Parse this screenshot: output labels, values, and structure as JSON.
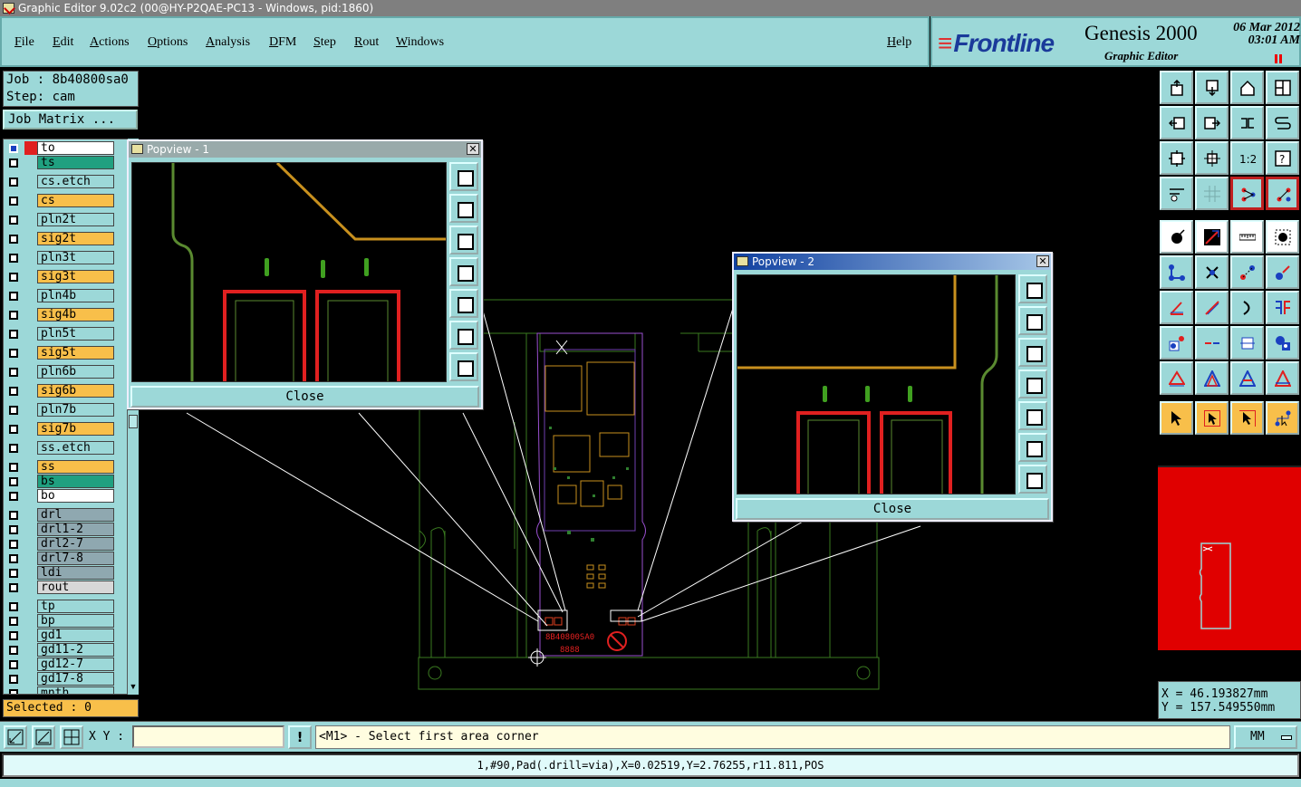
{
  "window": {
    "title": "Graphic Editor 9.02c2 (00@HY-P2QAE-PC13 - Windows, pid:1860)"
  },
  "menu": {
    "items": [
      "File",
      "Edit",
      "Actions",
      "Options",
      "Analysis",
      "DFM",
      "Step",
      "Rout",
      "Windows"
    ],
    "help": "Help"
  },
  "brand": {
    "logo": "Frontline",
    "product": "Genesis 2000",
    "subtitle": "Graphic Editor",
    "date": "06 Mar 2012",
    "time": "03:01 AM"
  },
  "job": {
    "job_line": "Job : 8b40800sa0",
    "step_line": "Step: cam",
    "matrix_button": "Job Matrix ..."
  },
  "layers": [
    {
      "name": "to",
      "color": "#ffffff",
      "swatch": "#e02020",
      "active": true
    },
    {
      "name": "ts",
      "color": "#20a080"
    },
    {
      "name": "cs.etch",
      "color": "#9cd8d8"
    },
    {
      "name": "cs",
      "color": "#f8bf4a"
    },
    {
      "name": "pln2t",
      "color": "#9cd8d8"
    },
    {
      "name": "sig2t",
      "color": "#f8bf4a"
    },
    {
      "name": "pln3t",
      "color": "#9cd8d8"
    },
    {
      "name": "sig3t",
      "color": "#f8bf4a"
    },
    {
      "name": "pln4b",
      "color": "#9cd8d8"
    },
    {
      "name": "sig4b",
      "color": "#f8bf4a"
    },
    {
      "name": "pln5t",
      "color": "#9cd8d8"
    },
    {
      "name": "sig5t",
      "color": "#f8bf4a"
    },
    {
      "name": "pln6b",
      "color": "#9cd8d8"
    },
    {
      "name": "sig6b",
      "color": "#f8bf4a"
    },
    {
      "name": "pln7b",
      "color": "#9cd8d8"
    },
    {
      "name": "sig7b",
      "color": "#f8bf4a"
    },
    {
      "name": "ss.etch",
      "color": "#9cd8d8"
    },
    {
      "name": "ss",
      "color": "#f8bf4a"
    },
    {
      "name": "bs",
      "color": "#20a080"
    },
    {
      "name": "bo",
      "color": "#ffffff"
    },
    {
      "name": "drl",
      "color": "#8fa8b0"
    },
    {
      "name": "drl1-2",
      "color": "#8fa8b0"
    },
    {
      "name": "drl2-7",
      "color": "#8fa8b0"
    },
    {
      "name": "drl7-8",
      "color": "#8fa8b0"
    },
    {
      "name": "ldi",
      "color": "#8fa8b0"
    },
    {
      "name": "rout",
      "color": "#d8d8d8"
    },
    {
      "name": "tp",
      "color": "#9cd8d8"
    },
    {
      "name": "bp",
      "color": "#9cd8d8"
    },
    {
      "name": "gd1",
      "color": "#9cd8d8"
    },
    {
      "name": "gd11-2",
      "color": "#9cd8d8"
    },
    {
      "name": "gd12-7",
      "color": "#9cd8d8"
    },
    {
      "name": "gd17-8",
      "color": "#9cd8d8"
    },
    {
      "name": "mnth",
      "color": "#9cd8d8"
    }
  ],
  "selected": "Selected : 0",
  "popview1": {
    "title": "Popview - 1",
    "close_label": "Close"
  },
  "popview2": {
    "title": "Popview - 2",
    "close_label": "Close"
  },
  "coords": {
    "x": "X  =  46.193827mm",
    "y": "Y  = 157.549550mm"
  },
  "bottom": {
    "xy_label": "X Y :",
    "xy_value": "",
    "alert": "!",
    "prompt": "<M1> - Select first area corner",
    "units": "MM",
    "status": "1,#90,Pad(.drill=via),X=0.02519,Y=2.76255,r11.811,POS"
  },
  "board_text": {
    "part_no": "8B40800SA0",
    "date_code": "8888"
  },
  "colors": {
    "panel": "#9cd8d8",
    "highlight": "#f8bf4a",
    "profile": "#3a7a20",
    "pad": "#e02020",
    "trace": "#c8901e"
  }
}
